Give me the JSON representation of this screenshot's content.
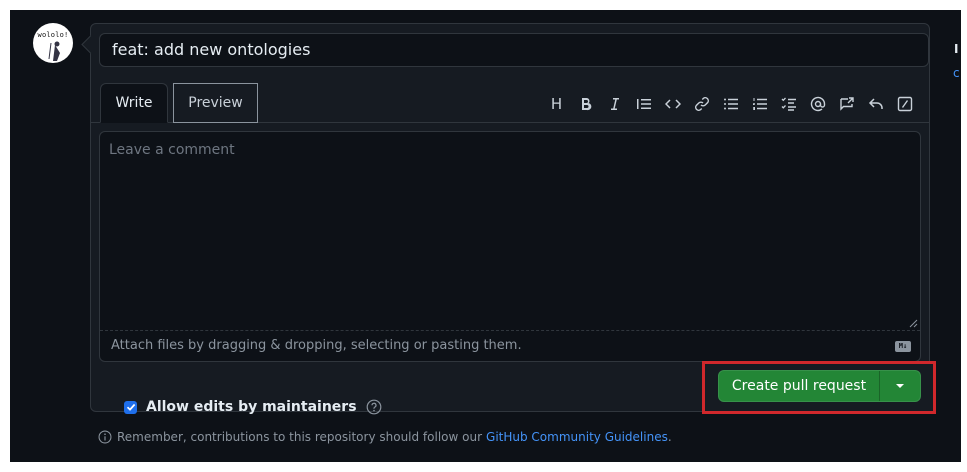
{
  "avatar": {
    "text": "wololo!"
  },
  "title_input": {
    "value": "feat: add new ontologies"
  },
  "tabs": [
    {
      "label": "Write"
    },
    {
      "label": "Preview"
    }
  ],
  "toolbar": {
    "icons": [
      "heading-icon",
      "bold-icon",
      "italic-icon",
      "quote-icon",
      "code-icon",
      "link-icon",
      "unordered-list-icon",
      "ordered-list-icon",
      "task-list-icon",
      "mention-icon",
      "cross-reference-icon",
      "saved-reply-icon",
      "slash-command-icon"
    ],
    "heading_glyph": "H"
  },
  "comment": {
    "placeholder": "Leave a comment",
    "value": ""
  },
  "attach": {
    "text": "Attach files by dragging & dropping, selecting or pasting them.",
    "md_badge": "M↓"
  },
  "allow_edits": {
    "label": "Allow edits by maintainers",
    "checked": true
  },
  "create_button": {
    "label": "Create pull request"
  },
  "footer": {
    "text": "Remember, contributions to this repository should follow our",
    "link": "GitHub Community Guidelines",
    "suffix": "."
  },
  "edge": {
    "text1": "I",
    "text2": "c"
  },
  "colors": {
    "primary_button": "#238636",
    "highlight_border": "#d0282c",
    "link": "#4493f8",
    "background": "#0d1117"
  }
}
